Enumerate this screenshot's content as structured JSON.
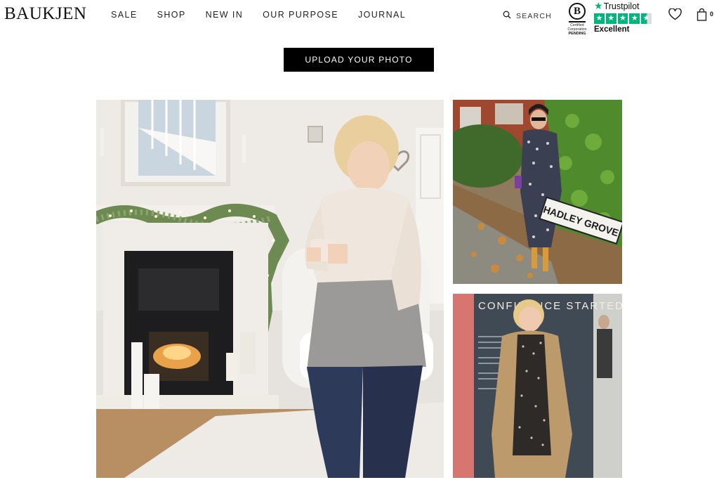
{
  "brand": {
    "logo_text": "BAUKJEN"
  },
  "nav": {
    "items": [
      {
        "label": "SALE"
      },
      {
        "label": "SHOP"
      },
      {
        "label": "NEW IN"
      },
      {
        "label": "OUR PURPOSE"
      },
      {
        "label": "JOURNAL"
      }
    ]
  },
  "search": {
    "label": "SEARCH",
    "icon": "search-icon"
  },
  "bcorp": {
    "letter": "B",
    "line1": "Certified",
    "line2": "Corporation",
    "status": "PENDING"
  },
  "trustpilot": {
    "brand": "Trustpilot",
    "rating_text": "Excellent",
    "stars": 4.5,
    "accent": "#00b67a"
  },
  "wishlist": {
    "icon": "heart-icon"
  },
  "cart": {
    "icon": "bag-icon",
    "count": "0"
  },
  "upload": {
    "label": "UPLOAD YOUR PHOTO"
  },
  "photos": {
    "items": [
      {
        "scene": "living room fireplace",
        "sign_text": ""
      },
      {
        "scene": "street sign",
        "sign_text": "HADLEY GROVE"
      },
      {
        "scene": "event",
        "sign_text": "CONFIDENCE STARTED"
      }
    ]
  }
}
